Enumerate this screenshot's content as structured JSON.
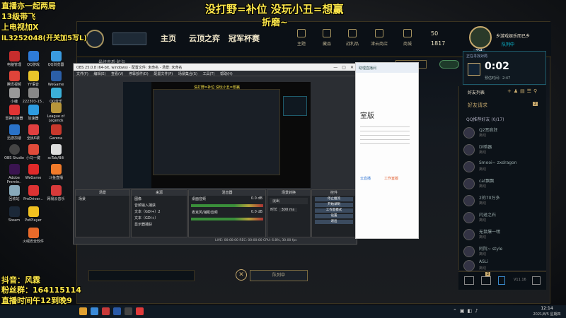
{
  "overlays": {
    "top_text": "没打野=补位 没玩小丑=想赢",
    "top_text2": "折磨~",
    "left_lines": [
      "直播亦一起两局",
      "13级带飞",
      "上电视加X",
      "lL3252048(开关加5写L)"
    ],
    "douyin": "抖音：风霖",
    "fans": "粉丝群：164115114",
    "live_time": "直播时间午12到晚9"
  },
  "desktop_icons": [
    "电脑管理",
    "QQ游戏",
    "QQ浏览器",
    "腾讯视频",
    "YY语音",
    "WeGame",
    "小编",
    "222303-15..",
    "QQ音乐",
    "雷神加速器",
    "加速器",
    "League of Legends",
    "迅游加速",
    "全民K歌",
    "Garena",
    "OBS Studio",
    "小马一键",
    "scTab/Bili",
    "Adobe Premie..",
    "WeGame",
    "斗鱼直播",
    "回收站",
    "ProDriver...",
    "网易云音乐",
    "Steam",
    "PotPlayer",
    "火绒安全软件"
  ],
  "client": {
    "nav": [
      "主页",
      "云顶之弈",
      "冠军杯赛"
    ],
    "top_icons": [
      "主题",
      "藏品",
      "战利品",
      "津云商店",
      "商城"
    ],
    "currency": [
      "50",
      "1817"
    ],
    "profile_name": "乡游戏娱乐而已乡",
    "profile_status": "队列中",
    "level": "354",
    "queue_title": "正在寻找对局",
    "queue_time": "0:02",
    "queue_sub": "预估时间：2:47",
    "friends_title": "好友列表",
    "friend_request": "好友请求",
    "friend_count": "2",
    "group_label": "QQ推荐好友 (0/17)",
    "friends": [
      {
        "name": "Q2耳疯狂",
        "status": "离线"
      },
      {
        "name": "Dl暗器",
        "status": "离线"
      },
      {
        "name": "Smooi~ zxdragon",
        "status": "离线"
      },
      {
        "name": "cat飘飘",
        "status": "离线"
      },
      {
        "name": "2的70万多",
        "status": "离线"
      },
      {
        "name": "闪退之石",
        "status": "离线"
      },
      {
        "name": "无鼠爆一嘿",
        "status": "离线"
      },
      {
        "name": "阿阮~ style",
        "status": "离线"
      },
      {
        "name": "ASLi",
        "status": "离线"
      }
    ],
    "bottom_btn": "队列中",
    "version": "V11.16",
    "partial": [
      "最终查看·脏沟",
      "好友",
      "Ad Rts",
      "乐成",
      "V"
    ]
  },
  "obs": {
    "title": "OBS 25.0.8 (64-bit, windows) - 配置文件: 未命名 - 场景: 未命名",
    "menu": [
      "文件(F)",
      "编辑(E)",
      "查看(V)",
      "停靠部件(D)",
      "配置文件(P)",
      "场景集合(S)",
      "工具(T)",
      "帮助(H)"
    ],
    "docks": [
      "场景",
      "来源",
      "混音器",
      "场景转换",
      "控件"
    ],
    "scene_item": "场景",
    "sources": [
      "图像",
      "音频输入捕获",
      "文本（GDI+）2",
      "文本（GDI+）",
      "显示器捕获"
    ],
    "mixer": [
      {
        "name": "桌面音频",
        "db": "0.0 dB"
      },
      {
        "name": "麦克风/辅助音频",
        "db": "0.0 dB"
      }
    ],
    "transition": "淡出",
    "duration_label": "时长",
    "duration": "300 ms",
    "controls": [
      "停止推流",
      "开始录制",
      "工作室模式",
      "设置",
      "退出"
    ],
    "status": "LIVE: 00:00:00  REC: 00:00:00  CPU: 6.8%, 30.00 fps"
  },
  "popup": {
    "title": "助理直播间",
    "heading": "室版",
    "btn1": "云直播",
    "btn2": "工作室版"
  },
  "taskbar": {
    "time": "12:14",
    "date": "2021/8/5 星期四"
  }
}
